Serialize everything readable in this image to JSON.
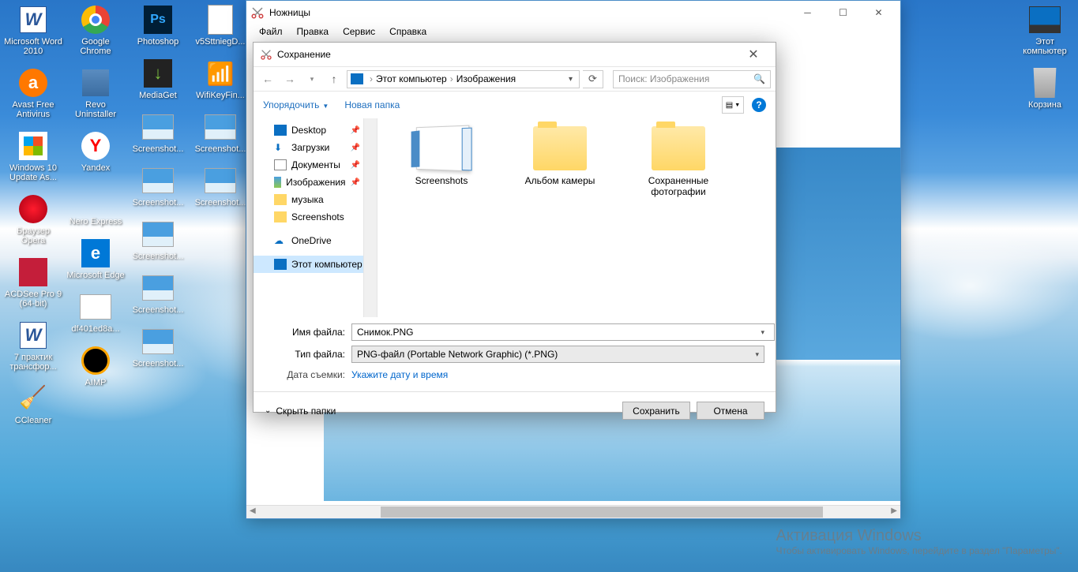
{
  "desktop": {
    "cols": [
      [
        {
          "name": "word",
          "label": "Microsoft Word 2010",
          "cls": "ic-word",
          "txt": "W"
        },
        {
          "name": "avast",
          "label": "Avast Free Antivirus",
          "cls": "ic-avast"
        },
        {
          "name": "winupdate",
          "label": "Windows 10 Update As...",
          "cls": "ic-winup"
        },
        {
          "name": "opera",
          "label": "Браузер Opera",
          "cls": "ic-opera"
        },
        {
          "name": "acdsee",
          "label": "ACDSee Pro 9 (64-bit)",
          "cls": "ic-acd"
        },
        {
          "name": "7praktik",
          "label": "7 практик трансфор...",
          "cls": "ic-word",
          "txt": "W"
        },
        {
          "name": "ccleaner",
          "label": "CCleaner",
          "cls": "ic-ccl"
        }
      ],
      [
        {
          "name": "chrome",
          "label": "Google Chrome",
          "cls": "ic-chrome"
        },
        {
          "name": "revo",
          "label": "Revo Uninstaller",
          "cls": "ic-revo"
        },
        {
          "name": "yandex",
          "label": "Yandex",
          "cls": "ic-yandex",
          "txt": "Y"
        },
        {
          "name": "nero",
          "label": "Nero Express",
          "cls": "ic-nero"
        },
        {
          "name": "edge",
          "label": "Microsoft Edge",
          "cls": "ic-edge",
          "txt": "e"
        },
        {
          "name": "df401",
          "label": "df401ed8a...",
          "cls": "ic-thumb"
        },
        {
          "name": "aimp",
          "label": "AIMP",
          "cls": "ic-aimp"
        }
      ],
      [
        {
          "name": "ps",
          "label": "Photoshop",
          "cls": "ic-ps",
          "txt": "Ps"
        },
        {
          "name": "mediaget",
          "label": "MediaGet",
          "cls": "ic-mediaget",
          "txt": "↓"
        },
        {
          "name": "scr1",
          "label": "Screenshot...",
          "cls": "ic-thumb sky"
        },
        {
          "name": "scr2",
          "label": "Screenshot...",
          "cls": "ic-thumb sky"
        },
        {
          "name": "scr3",
          "label": "Screenshot...",
          "cls": "ic-thumb sky"
        },
        {
          "name": "scr4",
          "label": "Screenshot...",
          "cls": "ic-thumb sky"
        },
        {
          "name": "scr5",
          "label": "Screenshot...",
          "cls": "ic-thumb sky"
        }
      ],
      [
        {
          "name": "v5stt",
          "label": "v5SttniegD...",
          "cls": "ic-file"
        },
        {
          "name": "wifikey",
          "label": "WifiKeyFin...",
          "cls": "ic-wifi",
          "txt": "📶"
        },
        {
          "name": "scr6",
          "label": "Screenshot...",
          "cls": "ic-thumb sky"
        },
        {
          "name": "scr7",
          "label": "Screenshot...",
          "cls": "ic-thumb sky"
        }
      ]
    ],
    "right": [
      {
        "name": "this-pc",
        "label": "Этот компьютер",
        "cls": "ic-pc"
      },
      {
        "name": "recycle",
        "label": "Корзина",
        "cls": "ic-bin"
      }
    ]
  },
  "snip": {
    "title": "Ножницы",
    "menu": [
      "Файл",
      "Правка",
      "Сервис",
      "Справка"
    ]
  },
  "save": {
    "title": "Сохранение",
    "breadcrumb": {
      "root": "Этот компьютер",
      "cur": "Изображения"
    },
    "search_placeholder": "Поиск: Изображения",
    "organize": "Упорядочить",
    "newfolder": "Новая папка",
    "tree": [
      {
        "label": "Desktop",
        "ico": "ico-desk",
        "pin": true
      },
      {
        "label": "Загрузки",
        "ico": "ico-dl",
        "pin": true,
        "txt": "⬇"
      },
      {
        "label": "Документы",
        "ico": "ico-doc",
        "pin": true
      },
      {
        "label": "Изображения",
        "ico": "ico-img",
        "pin": true
      },
      {
        "label": "музыка",
        "ico": "ico-mus"
      },
      {
        "label": "Screenshots",
        "ico": "ico-fold"
      },
      {
        "label": "OneDrive",
        "ico": "ico-od",
        "txt": "☁",
        "gap": true
      },
      {
        "label": "Этот компьютер",
        "ico": "ico-pc",
        "sel": true,
        "gap": true
      }
    ],
    "folders": [
      {
        "label": "Screenshots",
        "type": "scr"
      },
      {
        "label": "Альбом камеры",
        "type": "open"
      },
      {
        "label": "Сохраненные фотографии",
        "type": "open"
      }
    ],
    "filename_label": "Имя файла:",
    "filename": "Снимок.PNG",
    "filetype_label": "Тип файла:",
    "filetype": "PNG-файл (Portable Network Graphic) (*.PNG)",
    "date_label": "Дата съемки:",
    "date_link": "Укажите дату и время",
    "hide_folders": "Скрыть папки",
    "save_btn": "Сохранить",
    "cancel_btn": "Отмена"
  },
  "watermark": {
    "title": "Активация Windows",
    "line": "Чтобы активировать Windows, перейдите в раздел \"Параметры\"."
  }
}
